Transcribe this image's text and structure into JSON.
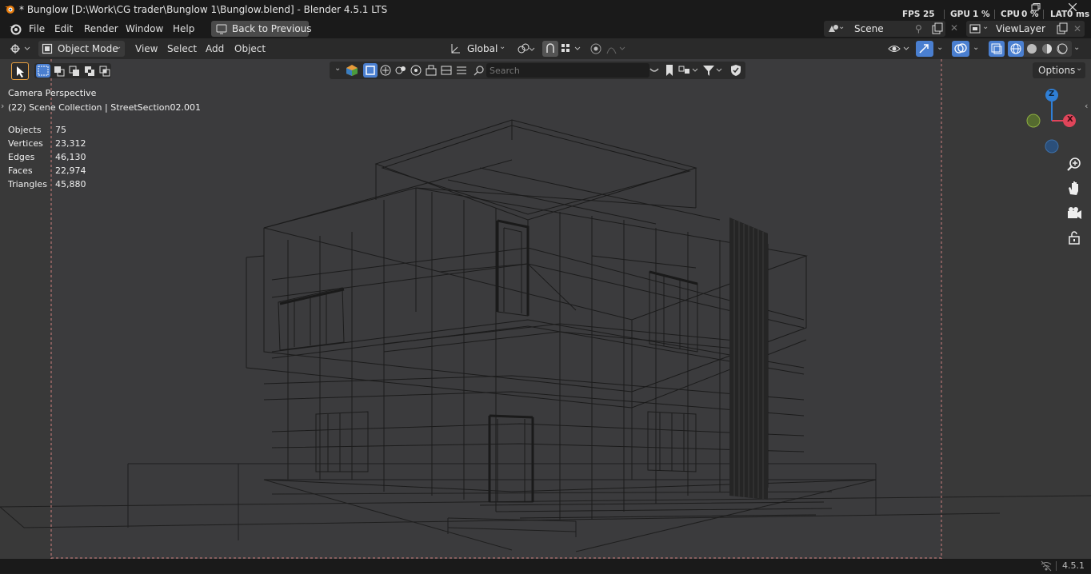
{
  "window": {
    "title": "* Bunglow [D:\\Work\\CG trader\\Bunglow 1\\Bunglow.blend] - Blender 4.5.1 LTS",
    "stats": {
      "fps_label": "FPS",
      "fps_value": "25",
      "gpu_label": "GPU",
      "gpu_value": "1 %",
      "cpu_label": "CPU",
      "cpu_value": "0 %",
      "lat_label": "LAT",
      "lat_value": "0 ms"
    }
  },
  "menubar": {
    "items": [
      "File",
      "Edit",
      "Render",
      "Window",
      "Help"
    ],
    "back_button": "Back to Previous",
    "scene": "Scene",
    "view_layer": "ViewLayer"
  },
  "viewport_header": {
    "mode": "Object Mode",
    "menus": [
      "View",
      "Select",
      "Add",
      "Object"
    ],
    "orientation": "Global",
    "options": "Options",
    "search_placeholder": "Search"
  },
  "overlay": {
    "camera": "Camera Perspective",
    "collection": "(22) Scene Collection | StreetSection02.001",
    "stats": [
      {
        "label": "Objects",
        "value": "75"
      },
      {
        "label": "Vertices",
        "value": "23,312"
      },
      {
        "label": "Edges",
        "value": "46,130"
      },
      {
        "label": "Faces",
        "value": "22,974"
      },
      {
        "label": "Triangles",
        "value": "45,880"
      }
    ]
  },
  "gizmo": {
    "z": "Z",
    "x": "X",
    "z_color": "#2f7fd6",
    "x_color": "#e0455a",
    "y_color": "#7aa23a"
  },
  "status": {
    "version": "4.5.1"
  },
  "colors": {
    "accent": "#4a7fd0",
    "viewport_bg": "#393939"
  },
  "icons": [
    "blender-logo-icon",
    "editor-type-icon",
    "select-tool-icon",
    "search-icon",
    "filter-icon",
    "zoom-icon",
    "hand-icon",
    "camera-icon",
    "lock-icon"
  ]
}
